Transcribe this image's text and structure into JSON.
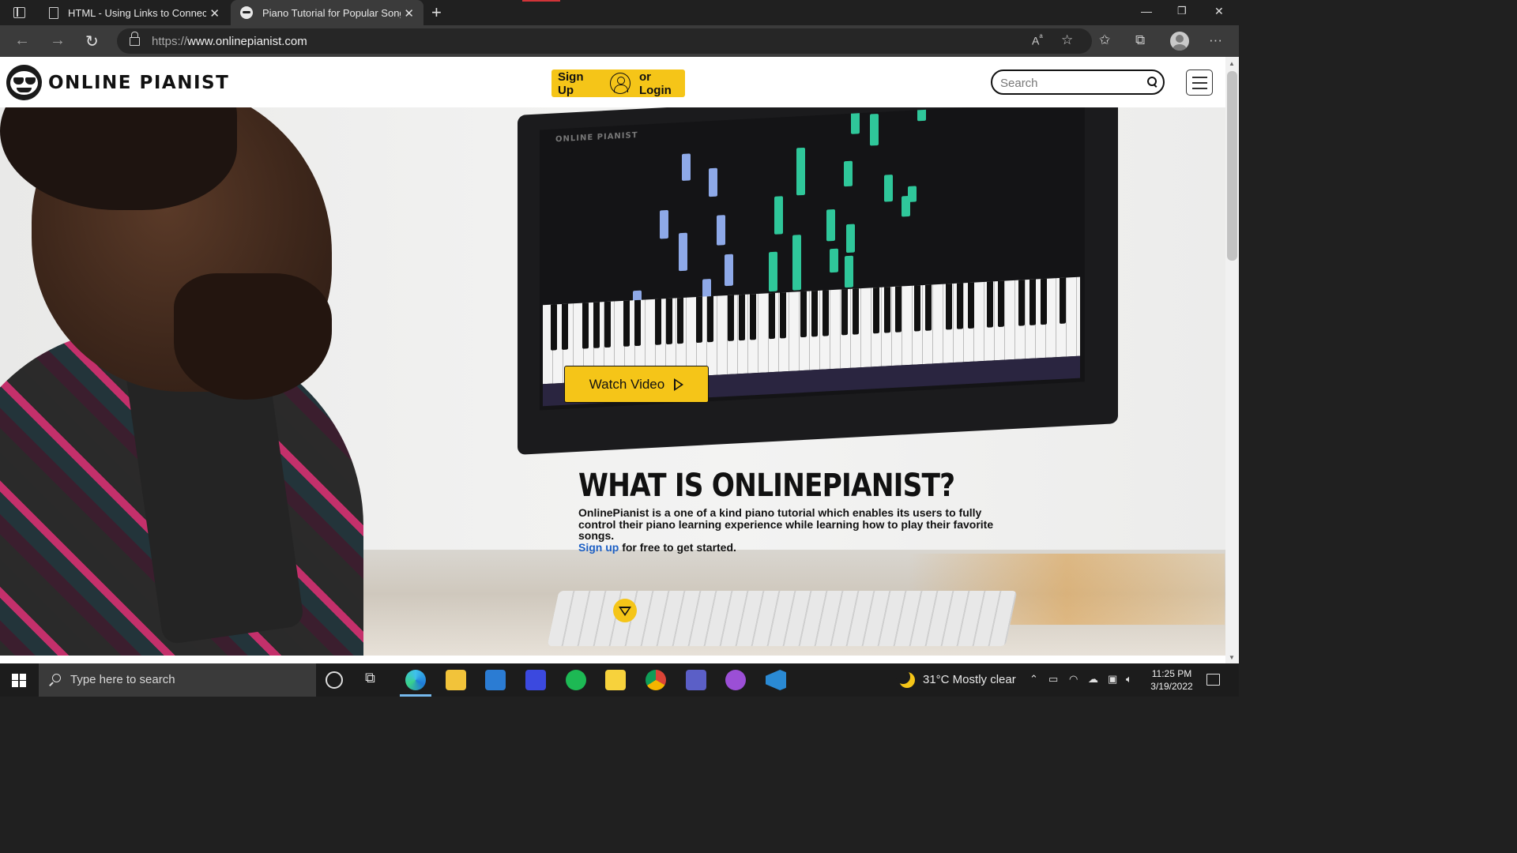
{
  "browser": {
    "tabs": [
      {
        "label": "HTML - Using Links to Connect V",
        "active": false
      },
      {
        "label": "Piano Tutorial for Popular Songs",
        "active": true
      }
    ],
    "url_scheme": "https://",
    "url_host": "www.onlinepianist.com"
  },
  "site": {
    "logo_text": "ONLINE PIANIST",
    "signup_label": "Sign Up",
    "login_label": "or Login",
    "search_placeholder": "Search",
    "search_value": ""
  },
  "hero": {
    "watch_video_label": "Watch Video",
    "screen_label": "ONLINE PIANIST",
    "info_title": "WHAT IS ONLINEPIANIST?",
    "info_body": "OnlinePianist is a one of a kind piano tutorial which enables its users to fully control their piano learning experience while learning how to play their favorite songs.",
    "info_link": "Sign up",
    "info_tail": " for free to get started."
  },
  "taskbar": {
    "search_placeholder": "Type here to search",
    "weather": "31°C  Mostly clear",
    "time": "11:25 PM",
    "date": "3/19/2022"
  },
  "colors": {
    "brand_yellow": "#f5c518",
    "link_blue": "#1c5fc4",
    "note_green": "#2fc79a",
    "note_blue": "#8ea9e8"
  }
}
